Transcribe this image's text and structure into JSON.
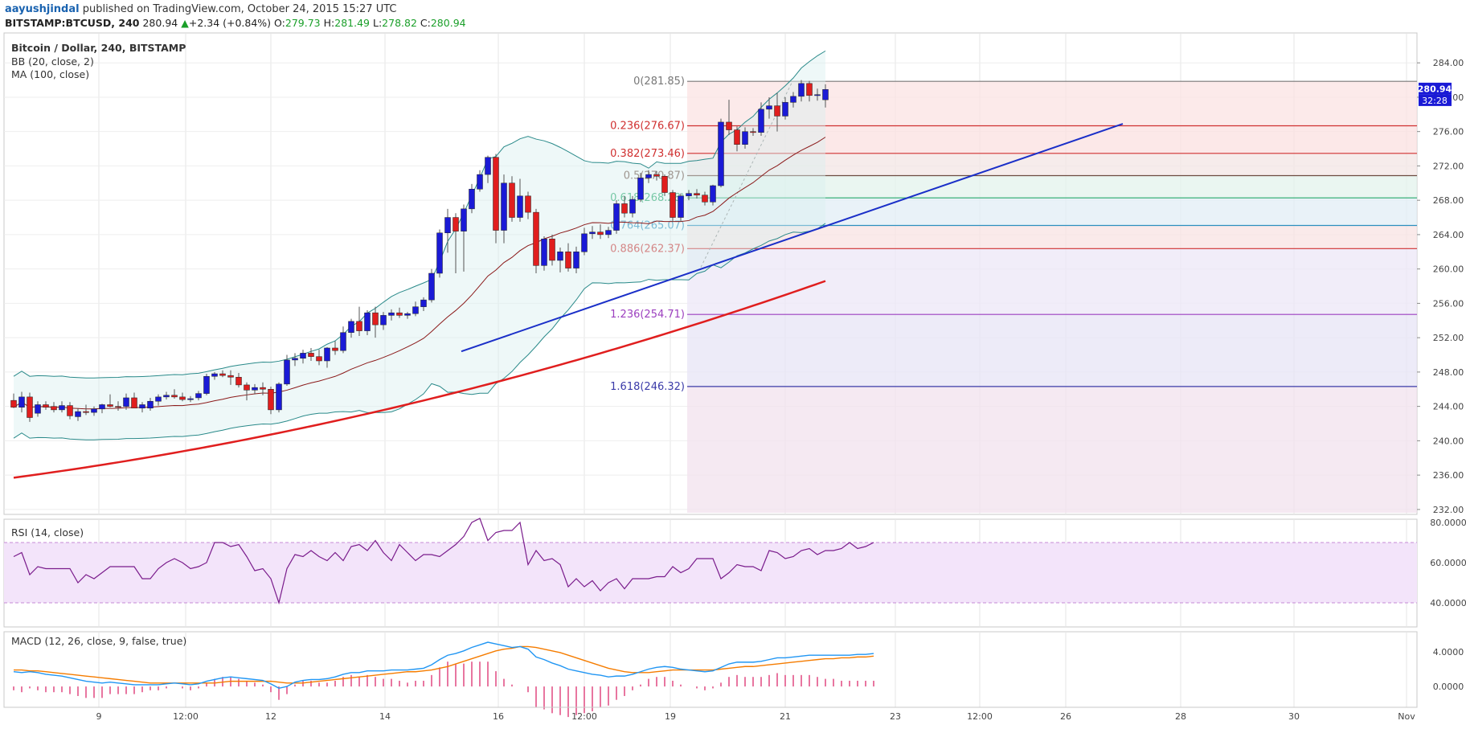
{
  "header": {
    "author": "aayushjindal",
    "published_text": " published on TradingView.com, October 24, 2015 15:27 UTC",
    "symbol_line": "BITSTAMP:BTCUSD, 240",
    "last": "280.94",
    "change": "+2.34 (+0.84%)",
    "o_label": "O:",
    "o_value": "279.73",
    "h_label": "H:",
    "h_value": "281.49",
    "l_label": "L:",
    "l_value": "278.82",
    "c_label": "C:",
    "c_value": "280.94",
    "up_arrow": "▲"
  },
  "colors": {
    "up": "#1a1ad6",
    "down": "#e01e1e",
    "ma": "#e01e1e",
    "bb_mid": "#8b1a1a",
    "bb_band": "#2a8a8a",
    "trendline": "#1a2fc8",
    "rsi": "#7a1c8c",
    "macd": "#2196f3",
    "signal": "#f57c00",
    "hist": "#d81b60"
  },
  "chart_data": [
    {
      "type": "candlestick",
      "title": "Bitcoin / Dollar, 240, BITSTAMP",
      "indicators": [
        "BB (20, close, 2)",
        "MA (100, close)"
      ],
      "price_axis_ticks": [
        "284.00",
        "280.00",
        "276.00",
        "272.00",
        "268.00",
        "264.00",
        "260.00",
        "256.00",
        "252.00",
        "248.00",
        "244.00",
        "240.00",
        "236.00",
        "232.00"
      ],
      "ylim": [
        231.8,
        287.2
      ],
      "time_axis_ticks": [
        "9",
        "12:00",
        "12",
        "14",
        "16",
        "12:00",
        "19",
        "21",
        "23",
        "12:00",
        "26",
        "28",
        "30",
        "Nov"
      ],
      "last_price_tag": "280.94",
      "countdown_tag": "32:28",
      "fibonacci": [
        {
          "label": "0(281.85)",
          "price": 281.85,
          "color": "#787878"
        },
        {
          "label": "0.236(276.67)",
          "price": 276.67,
          "color": "#d03030"
        },
        {
          "label": "0.382(273.46)",
          "price": 273.46,
          "color": "#d03030"
        },
        {
          "label": "0.5(270.87)",
          "price": 270.87,
          "color": "#6d4c41"
        },
        {
          "label": "0.618(268.28)",
          "price": 268.28,
          "color": "#26a86a"
        },
        {
          "label": "0.764(265.07)",
          "price": 265.07,
          "color": "#2b8fbf"
        },
        {
          "label": "0.886(262.37)",
          "price": 262.37,
          "color": "#d03030"
        },
        {
          "label": "1.236(254.71)",
          "price": 254.71,
          "color": "#9c3fbf"
        },
        {
          "label": "1.618(246.32)",
          "price": 246.32,
          "color": "#3a3aa8"
        }
      ],
      "trendline": {
        "from": [
          "Oct 15",
          250.4
        ],
        "to": [
          "Oct 25",
          276.9
        ]
      },
      "candles": [
        [
          244.7,
          245.5,
          243.8,
          243.9
        ],
        [
          243.9,
          245.7,
          243.3,
          245.1
        ],
        [
          245.1,
          245.6,
          242.2,
          242.7
        ],
        [
          243.2,
          244.6,
          242.8,
          244.2
        ],
        [
          244.2,
          244.6,
          243.6,
          243.9
        ],
        [
          244.0,
          244.5,
          243.3,
          243.6
        ],
        [
          243.6,
          244.6,
          243.3,
          244.1
        ],
        [
          244.1,
          244.5,
          242.5,
          242.9
        ],
        [
          242.8,
          243.8,
          242.3,
          243.4
        ],
        [
          243.4,
          244.2,
          243.0,
          243.3
        ],
        [
          243.3,
          244.0,
          242.9,
          243.7
        ],
        [
          243.7,
          244.3,
          243.2,
          244.2
        ],
        [
          244.2,
          245.4,
          243.9,
          244.0
        ],
        [
          244.0,
          244.6,
          243.5,
          243.9
        ],
        [
          244.0,
          245.5,
          243.6,
          245.0
        ],
        [
          245.0,
          245.6,
          243.9,
          243.8
        ],
        [
          243.8,
          244.5,
          243.3,
          244.2
        ],
        [
          243.8,
          245.0,
          243.5,
          244.6
        ],
        [
          244.6,
          245.4,
          244.1,
          245.1
        ],
        [
          245.1,
          245.7,
          244.8,
          245.3
        ],
        [
          245.3,
          246.0,
          244.9,
          245.1
        ],
        [
          245.1,
          245.6,
          244.6,
          244.8
        ],
        [
          244.8,
          245.2,
          244.5,
          244.9
        ],
        [
          245.0,
          245.8,
          244.7,
          245.5
        ],
        [
          245.5,
          247.8,
          245.3,
          247.5
        ],
        [
          247.5,
          248.0,
          247.1,
          247.8
        ],
        [
          247.8,
          248.2,
          247.4,
          247.6
        ],
        [
          247.6,
          248.2,
          246.5,
          247.4
        ],
        [
          247.4,
          247.9,
          246.2,
          246.5
        ],
        [
          246.5,
          246.8,
          244.7,
          245.9
        ],
        [
          245.9,
          246.6,
          245.4,
          246.2
        ],
        [
          246.2,
          246.8,
          245.3,
          246.0
        ],
        [
          246.0,
          246.3,
          243.1,
          243.6
        ],
        [
          243.6,
          246.8,
          243.3,
          246.6
        ],
        [
          246.6,
          250.0,
          246.4,
          249.4
        ],
        [
          249.4,
          250.2,
          248.7,
          249.6
        ],
        [
          249.6,
          250.6,
          249.0,
          250.2
        ],
        [
          250.2,
          250.8,
          249.3,
          249.8
        ],
        [
          249.8,
          250.6,
          248.8,
          249.3
        ],
        [
          249.3,
          250.9,
          248.5,
          250.8
        ],
        [
          250.8,
          251.6,
          250.0,
          250.5
        ],
        [
          250.5,
          253.3,
          250.2,
          252.6
        ],
        [
          252.6,
          254.2,
          252.0,
          253.9
        ],
        [
          253.9,
          255.6,
          252.2,
          252.8
        ],
        [
          252.8,
          255.2,
          252.3,
          254.9
        ],
        [
          254.9,
          255.6,
          252.0,
          253.5
        ],
        [
          253.5,
          255.0,
          252.9,
          254.6
        ],
        [
          254.6,
          255.3,
          254.0,
          254.9
        ],
        [
          254.9,
          255.5,
          254.3,
          254.6
        ],
        [
          254.6,
          255.0,
          254.2,
          254.8
        ],
        [
          254.8,
          256.2,
          254.5,
          255.6
        ],
        [
          255.6,
          256.7,
          255.1,
          256.4
        ],
        [
          256.4,
          260.0,
          256.1,
          259.5
        ],
        [
          259.5,
          264.6,
          259.0,
          264.2
        ],
        [
          264.2,
          267.0,
          261.9,
          266.0
        ],
        [
          266.0,
          266.5,
          259.5,
          264.4
        ],
        [
          264.4,
          267.5,
          259.7,
          267.0
        ],
        [
          267.0,
          269.9,
          266.5,
          269.3
        ],
        [
          269.3,
          271.5,
          269.0,
          271.0
        ],
        [
          271.0,
          273.2,
          270.0,
          273.0
        ],
        [
          273.0,
          273.4,
          263.0,
          264.5
        ],
        [
          264.5,
          271.0,
          263.0,
          270.0
        ],
        [
          270.0,
          270.8,
          265.5,
          266.0
        ],
        [
          266.0,
          270.5,
          265.5,
          268.5
        ],
        [
          268.5,
          269.0,
          265.8,
          266.6
        ],
        [
          266.6,
          267.0,
          259.5,
          260.4
        ],
        [
          260.4,
          263.8,
          259.8,
          263.5
        ],
        [
          263.5,
          264.0,
          260.4,
          261.0
        ],
        [
          261.0,
          262.5,
          259.6,
          262.0
        ],
        [
          262.0,
          263.0,
          259.7,
          260.1
        ],
        [
          260.1,
          262.6,
          259.5,
          262.0
        ],
        [
          262.0,
          264.8,
          261.6,
          264.1
        ],
        [
          264.1,
          265.0,
          263.5,
          264.3
        ],
        [
          264.3,
          265.2,
          263.5,
          264.0
        ],
        [
          264.0,
          264.9,
          263.6,
          264.5
        ],
        [
          264.5,
          268.0,
          264.1,
          267.6
        ],
        [
          267.6,
          268.5,
          266.0,
          266.5
        ],
        [
          266.5,
          268.5,
          266.0,
          268.1
        ],
        [
          268.1,
          271.2,
          267.8,
          270.6
        ],
        [
          270.6,
          271.5,
          270.0,
          271.0
        ],
        [
          271.0,
          271.4,
          270.3,
          270.8
        ],
        [
          270.8,
          271.0,
          268.5,
          268.9
        ],
        [
          268.9,
          269.2,
          265.5,
          266.0
        ],
        [
          266.0,
          268.8,
          265.5,
          268.5
        ],
        [
          268.5,
          269.2,
          268.0,
          268.8
        ],
        [
          268.8,
          269.3,
          268.2,
          268.6
        ],
        [
          268.6,
          269.0,
          267.4,
          267.8
        ],
        [
          267.8,
          269.8,
          267.4,
          269.7
        ],
        [
          269.7,
          277.5,
          269.5,
          277.1
        ],
        [
          277.1,
          279.7,
          275.6,
          276.2
        ],
        [
          276.2,
          276.6,
          273.7,
          274.5
        ],
        [
          274.5,
          276.5,
          274.0,
          276.0
        ],
        [
          276.0,
          276.4,
          275.5,
          275.9
        ],
        [
          275.9,
          279.4,
          275.5,
          278.6
        ],
        [
          278.6,
          280.0,
          277.5,
          279.0
        ],
        [
          279.0,
          280.5,
          276.0,
          277.8
        ],
        [
          277.8,
          280.0,
          277.4,
          279.4
        ],
        [
          279.4,
          280.6,
          278.8,
          280.1
        ],
        [
          280.1,
          282.0,
          279.5,
          281.6
        ],
        [
          281.6,
          281.9,
          279.5,
          280.2
        ],
        [
          280.2,
          281.0,
          279.6,
          280.3
        ],
        [
          279.7,
          281.5,
          278.8,
          280.9
        ]
      ],
      "ma100_end": 258.6,
      "bb_upper_end": 284.2,
      "bb_lower_end": 265.3
    },
    {
      "type": "line",
      "title": "RSI (14, close)",
      "axis_ticks": [
        "80.0000",
        "60.0000",
        "40.0000"
      ],
      "ylim": [
        28,
        82
      ],
      "band": [
        40,
        70
      ],
      "values": [
        63,
        65,
        54,
        58,
        57,
        57,
        57,
        57,
        50,
        54,
        52,
        55,
        58,
        58,
        58,
        58,
        52,
        52,
        57,
        60,
        62,
        60,
        57,
        58,
        60,
        70,
        70,
        68,
        69,
        63,
        56,
        57,
        52,
        40,
        57,
        64,
        63,
        66,
        63,
        61,
        65,
        61,
        68,
        69,
        66,
        71,
        65,
        61,
        69,
        65,
        61,
        64,
        64,
        63,
        66,
        69,
        73,
        80,
        82,
        71,
        75,
        76,
        76,
        80,
        59,
        66,
        61,
        62,
        59,
        48,
        52,
        48,
        51,
        46,
        50,
        52,
        47,
        52,
        52,
        52,
        53,
        53,
        58,
        55,
        57,
        62,
        62,
        62,
        52,
        55,
        59,
        58,
        58,
        56,
        66,
        65,
        62,
        63,
        66,
        67,
        64,
        66,
        66,
        67,
        70,
        67,
        68,
        70
      ]
    },
    {
      "type": "line",
      "title": "MACD (12, 26, close, 9, false, true)",
      "axis_ticks": [
        "4.0000",
        "0.0000"
      ],
      "ylim": [
        -2.4,
        6.4
      ],
      "macd": [
        1.7,
        1.6,
        1.7,
        1.6,
        1.4,
        1.3,
        1.2,
        1.0,
        0.8,
        0.6,
        0.5,
        0.4,
        0.5,
        0.4,
        0.3,
        0.2,
        0.2,
        0.2,
        0.2,
        0.3,
        0.4,
        0.3,
        0.2,
        0.3,
        0.6,
        0.8,
        1.0,
        1.1,
        1.0,
        0.9,
        0.8,
        0.7,
        0.3,
        -0.2,
        0.0,
        0.5,
        0.7,
        0.8,
        0.8,
        0.9,
        1.1,
        1.4,
        1.6,
        1.6,
        1.8,
        1.8,
        1.8,
        1.9,
        1.9,
        1.9,
        2.0,
        2.1,
        2.5,
        3.1,
        3.6,
        3.8,
        4.1,
        4.5,
        4.8,
        5.1,
        4.9,
        4.7,
        4.5,
        4.6,
        4.3,
        3.4,
        3.1,
        2.7,
        2.4,
        2.0,
        1.8,
        1.6,
        1.4,
        1.3,
        1.1,
        1.2,
        1.2,
        1.4,
        1.7,
        2.0,
        2.2,
        2.3,
        2.2,
        2.0,
        1.9,
        1.8,
        1.7,
        1.8,
        2.2,
        2.6,
        2.8,
        2.8,
        2.8,
        2.9,
        3.1,
        3.3,
        3.3,
        3.4,
        3.5,
        3.6,
        3.6,
        3.6,
        3.6,
        3.6,
        3.6,
        3.7,
        3.7,
        3.8
      ],
      "signal": [
        1.9,
        1.9,
        1.8,
        1.8,
        1.7,
        1.6,
        1.5,
        1.4,
        1.3,
        1.2,
        1.1,
        1.0,
        0.9,
        0.8,
        0.7,
        0.6,
        0.5,
        0.4,
        0.4,
        0.4,
        0.4,
        0.4,
        0.4,
        0.4,
        0.4,
        0.4,
        0.5,
        0.6,
        0.6,
        0.6,
        0.6,
        0.6,
        0.6,
        0.5,
        0.4,
        0.4,
        0.4,
        0.5,
        0.6,
        0.7,
        0.8,
        0.9,
        1.0,
        1.1,
        1.2,
        1.3,
        1.4,
        1.5,
        1.6,
        1.7,
        1.7,
        1.8,
        1.9,
        2.1,
        2.3,
        2.6,
        2.9,
        3.2,
        3.5,
        3.8,
        4.1,
        4.3,
        4.4,
        4.6,
        4.6,
        4.5,
        4.3,
        4.1,
        3.9,
        3.6,
        3.3,
        3.0,
        2.7,
        2.4,
        2.1,
        1.9,
        1.7,
        1.6,
        1.6,
        1.6,
        1.7,
        1.8,
        1.9,
        1.9,
        1.9,
        1.9,
        1.9,
        1.9,
        2.0,
        2.1,
        2.2,
        2.3,
        2.3,
        2.4,
        2.5,
        2.6,
        2.7,
        2.8,
        2.9,
        3.0,
        3.1,
        3.2,
        3.2,
        3.3,
        3.3,
        3.4,
        3.4,
        3.5
      ]
    }
  ]
}
